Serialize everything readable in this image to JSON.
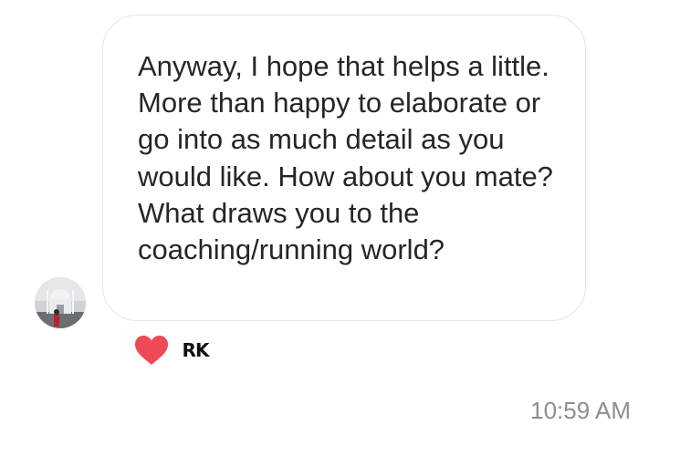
{
  "message": {
    "text": "Anyway, I hope that helps a little. More than happy to elaborate or go into as much detail as you would like. How about you mate? What draws you to the coaching/running world?"
  },
  "reaction": {
    "icon": "heart-icon",
    "color": "#ed4956",
    "reactor_initials": "RK"
  },
  "timestamp": "10:59 AM"
}
